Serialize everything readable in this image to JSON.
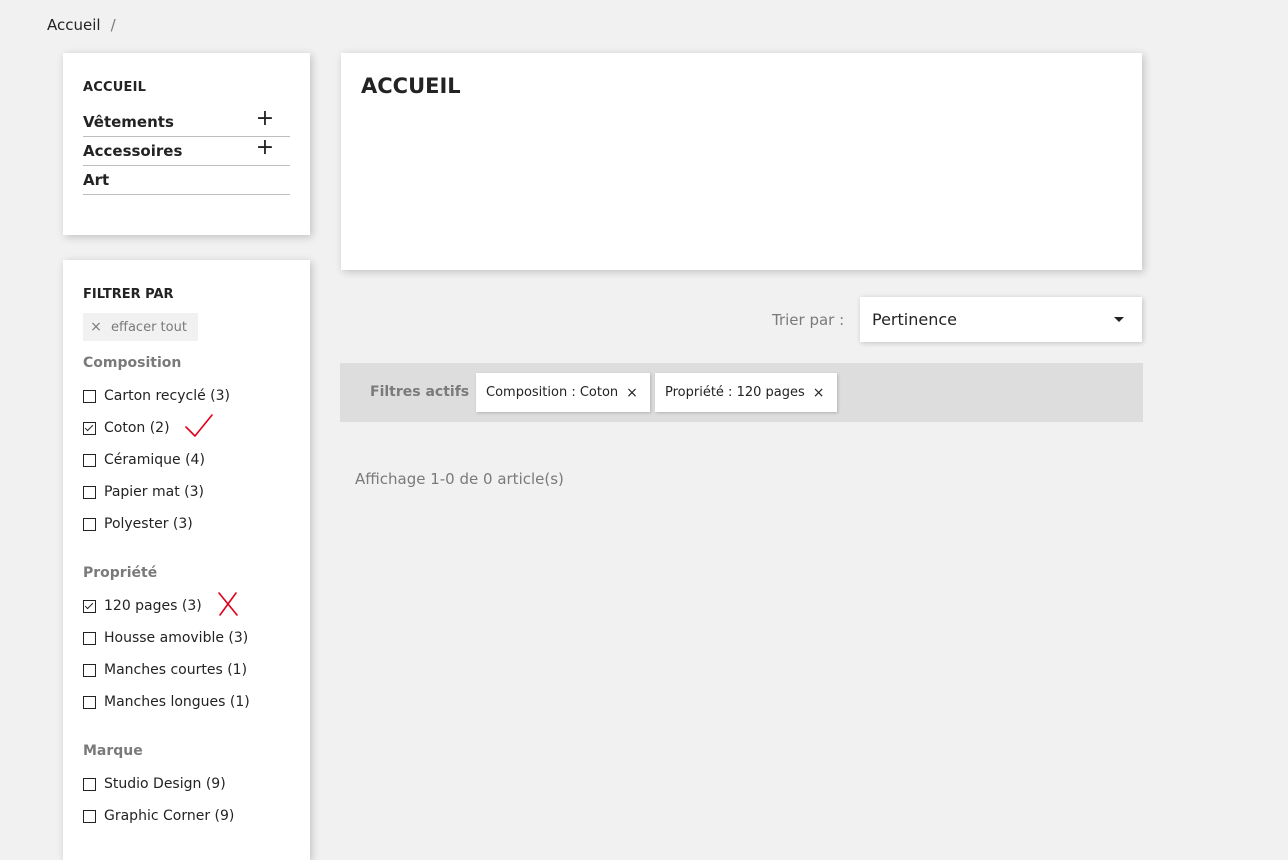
{
  "breadcrumb": {
    "home": "Accueil",
    "separator": "/"
  },
  "category_tree": {
    "title": "ACCUEIL",
    "items": [
      {
        "label": "Vêtements",
        "expand": "+"
      },
      {
        "label": "Accessoires",
        "expand": "+"
      },
      {
        "label": "Art"
      }
    ]
  },
  "filters": {
    "title": "FILTRER PAR",
    "clear_icon": "×",
    "clear_label": "effacer tout",
    "facets": [
      {
        "title": "Composition",
        "options": [
          {
            "label": "Carton recyclé (3)",
            "checked": false
          },
          {
            "label": "Coton (2)",
            "checked": true,
            "annotation": "red-checkmark"
          },
          {
            "label": "Céramique (4)",
            "checked": false
          },
          {
            "label": "Papier mat (3)",
            "checked": false
          },
          {
            "label": "Polyester (3)",
            "checked": false
          }
        ]
      },
      {
        "title": "Propriété",
        "options": [
          {
            "label": "120 pages (3)",
            "checked": true,
            "annotation": "red-cross"
          },
          {
            "label": "Housse amovible (3)",
            "checked": false
          },
          {
            "label": "Manches courtes (1)",
            "checked": false
          },
          {
            "label": "Manches longues (1)",
            "checked": false
          }
        ]
      },
      {
        "title": "Marque",
        "options": [
          {
            "label": "Studio Design (9)",
            "checked": false
          },
          {
            "label": "Graphic Corner (9)",
            "checked": false
          }
        ]
      }
    ]
  },
  "header": {
    "title": "ACCUEIL"
  },
  "sort": {
    "label": "Trier par :",
    "selected": "Pertinence"
  },
  "active_filters": {
    "label": "Filtres actifs",
    "close_icon": "×",
    "chips": [
      {
        "label": "Composition : Coton"
      },
      {
        "label": "Propriété : 120 pages"
      }
    ]
  },
  "results": {
    "count_text": "Affichage 1-0 de 0 article(s)"
  },
  "colors": {
    "background": "#f1f1f1",
    "text": "#232323",
    "muted": "#7a7a7a",
    "annotation_red": "#e0001b",
    "active_filters_bg": "#dddddd"
  }
}
